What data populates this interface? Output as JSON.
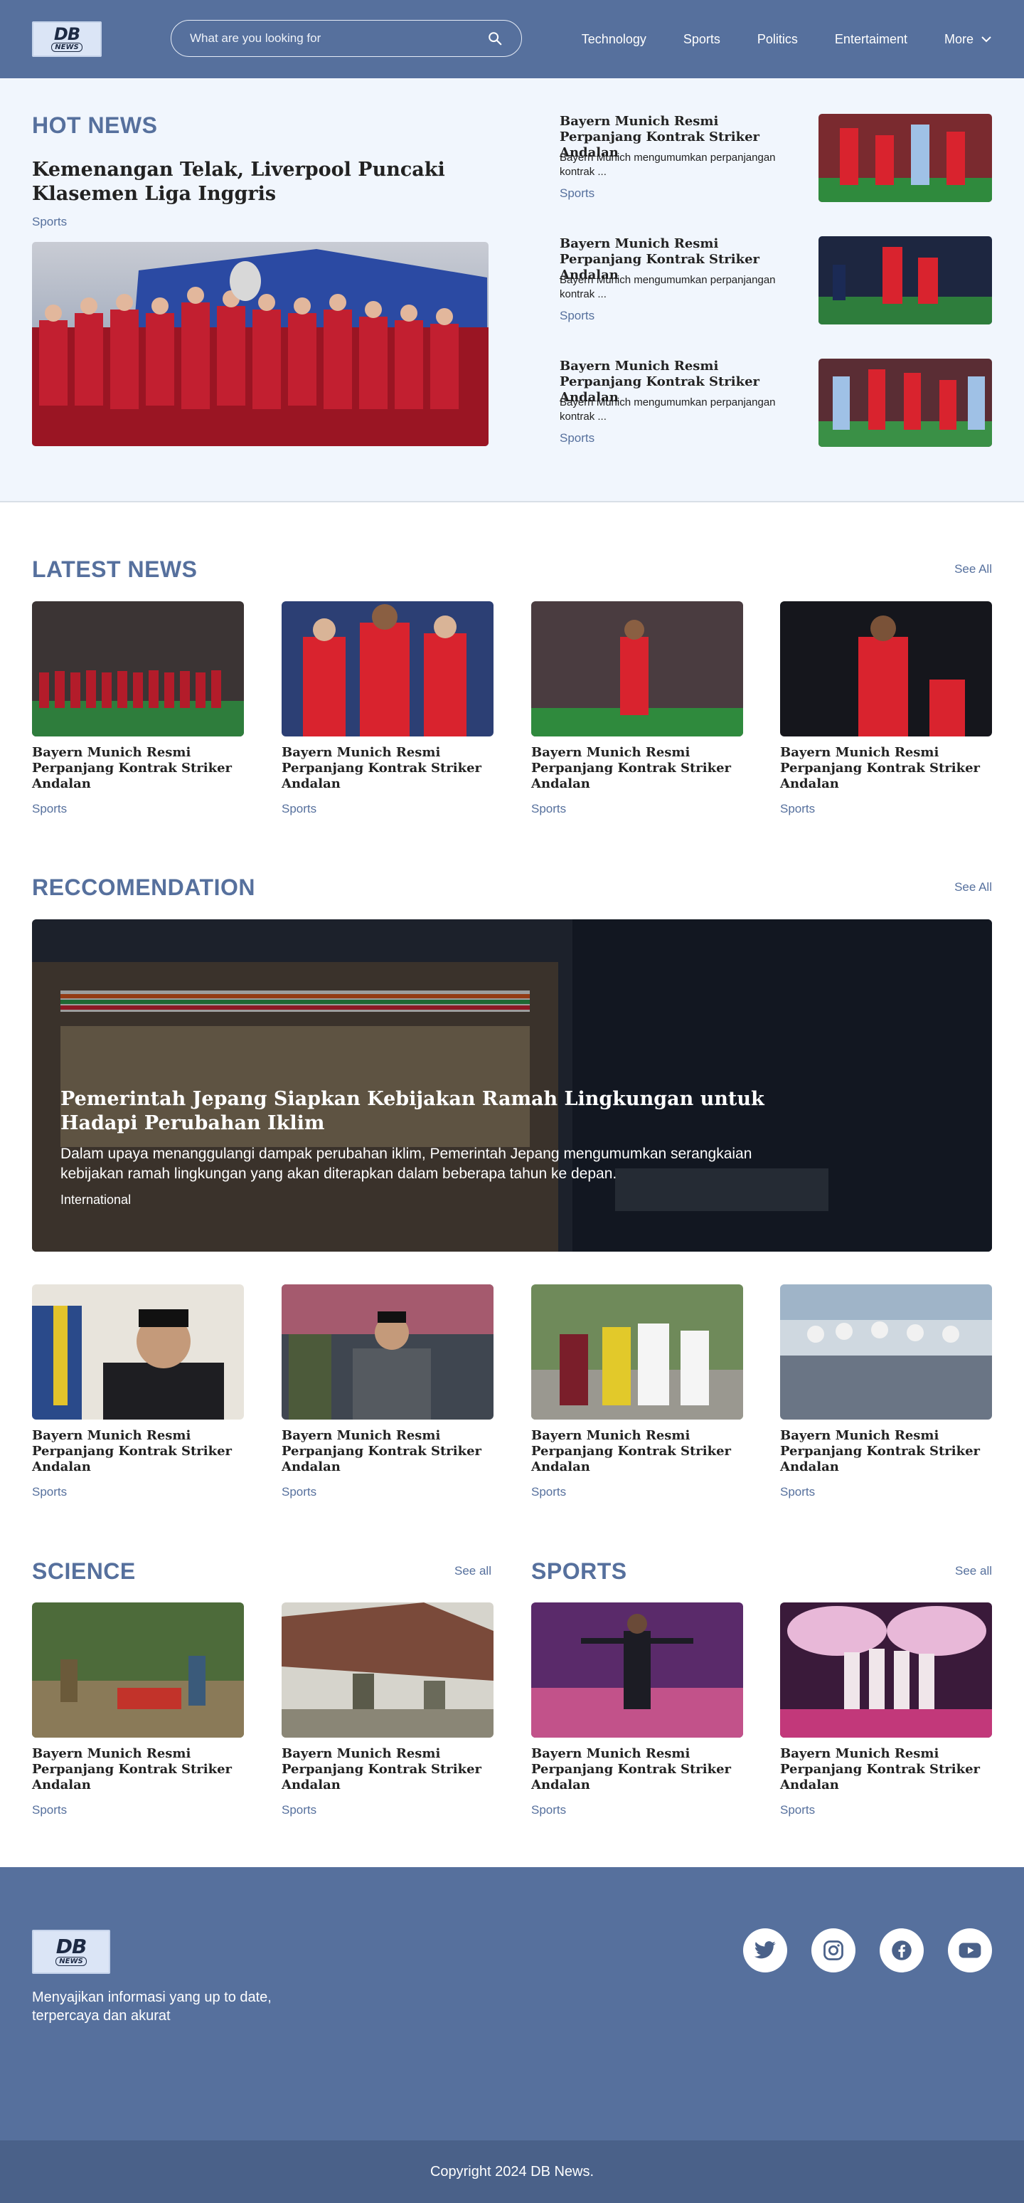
{
  "header": {
    "logo_top": "DB",
    "logo_bottom": "NEWS",
    "search_placeholder": "What are you looking for",
    "nav": [
      "Technology",
      "Sports",
      "Politics",
      "Entertaiment",
      "More"
    ]
  },
  "hot": {
    "title": "HOT NEWS",
    "headline": "Kemenangan Telak, Liverpool Puncaki Klasemen Liga Inggris",
    "category": "Sports",
    "side": [
      {
        "title": "Bayern Munich Resmi Perpanjang Kontrak Striker Andalan",
        "excerpt": "Bayern Munich mengumumkan perpanjangan kontrak ...",
        "category": "Sports"
      },
      {
        "title": "Bayern Munich Resmi Perpanjang Kontrak Striker Andalan",
        "excerpt": "Bayern Munich mengumumkan perpanjangan kontrak ...",
        "category": "Sports"
      },
      {
        "title": "Bayern Munich Resmi Perpanjang Kontrak Striker Andalan",
        "excerpt": "Bayern Munich mengumumkan perpanjangan kontrak ...",
        "category": "Sports"
      }
    ]
  },
  "latest": {
    "title": "LATEST NEWS",
    "see_all": "See All",
    "cards": [
      {
        "title": "Bayern Munich Resmi Perpanjang Kontrak Striker Andalan",
        "category": "Sports"
      },
      {
        "title": "Bayern Munich Resmi Perpanjang Kontrak Striker Andalan",
        "category": "Sports"
      },
      {
        "title": "Bayern Munich Resmi Perpanjang Kontrak Striker Andalan",
        "category": "Sports"
      },
      {
        "title": "Bayern Munich Resmi Perpanjang Kontrak Striker Andalan",
        "category": "Sports"
      }
    ]
  },
  "reco": {
    "title": "RECCOMENDATION",
    "see_all": "See All",
    "feature": {
      "title": "Pemerintah Jepang Siapkan Kebijakan Ramah Lingkungan untuk Hadapi Perubahan Iklim",
      "excerpt": "Dalam upaya menanggulangi dampak perubahan iklim, Pemerintah Jepang mengumumkan serangkaian kebijakan ramah lingkungan yang akan diterapkan dalam beberapa tahun ke depan.",
      "category": "International"
    },
    "cards": [
      {
        "title": "Bayern Munich Resmi Perpanjang Kontrak Striker Andalan",
        "category": "Sports"
      },
      {
        "title": "Bayern Munich Resmi Perpanjang Kontrak Striker Andalan",
        "category": "Sports"
      },
      {
        "title": "Bayern Munich Resmi Perpanjang Kontrak Striker Andalan",
        "category": "Sports"
      },
      {
        "title": "Bayern Munich Resmi Perpanjang Kontrak Striker Andalan",
        "category": "Sports"
      }
    ]
  },
  "science": {
    "title": "SCIENCE",
    "see_all": "See all",
    "cards": [
      {
        "title": "Bayern Munich Resmi Perpanjang Kontrak Striker Andalan",
        "category": "Sports"
      },
      {
        "title": "Bayern Munich Resmi Perpanjang Kontrak Striker Andalan",
        "category": "Sports"
      }
    ]
  },
  "sports": {
    "title": "SPORTS",
    "see_all": "See all",
    "cards": [
      {
        "title": "Bayern Munich Resmi Perpanjang Kontrak Striker Andalan",
        "category": "Sports"
      },
      {
        "title": "Bayern Munich Resmi Perpanjang Kontrak Striker Andalan",
        "category": "Sports"
      }
    ]
  },
  "footer": {
    "tagline": "Menyajikan informasi yang up to date, terpercaya dan akurat",
    "socials": [
      "twitter-icon",
      "instagram-icon",
      "facebook-icon",
      "youtube-icon"
    ],
    "copyright": "Copyright 2024 DB News."
  },
  "colors": {
    "brand": "#56709d",
    "hot_bg": "#f1f6fd",
    "footer_bottom": "#4a6189"
  }
}
